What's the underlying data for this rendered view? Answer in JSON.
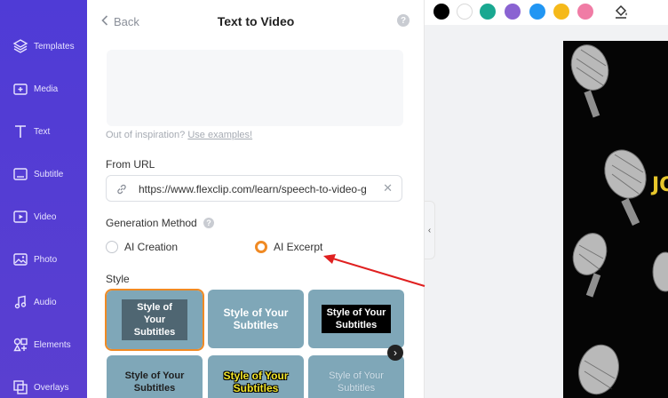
{
  "sidebar": {
    "items": [
      {
        "label": "Templates",
        "icon": "layers-icon"
      },
      {
        "label": "Media",
        "icon": "media-folder-icon"
      },
      {
        "label": "Text",
        "icon": "text-icon"
      },
      {
        "label": "Subtitle",
        "icon": "subtitle-icon"
      },
      {
        "label": "Video",
        "icon": "video-icon"
      },
      {
        "label": "Photo",
        "icon": "photo-icon"
      },
      {
        "label": "Audio",
        "icon": "audio-icon"
      },
      {
        "label": "Elements",
        "icon": "elements-icon"
      },
      {
        "label": "Overlays",
        "icon": "overlays-icon"
      }
    ]
  },
  "panel": {
    "back_label": "Back",
    "title": "Text to Video",
    "help": "?",
    "inspire_prefix": "Out of inspiration?",
    "inspire_link": "Use examples!",
    "from_url_label": "From URL",
    "url_value": "https://www.flexclip.com/learn/speech-to-video-g",
    "generation_label": "Generation Method",
    "options": [
      {
        "label": "AI Creation",
        "checked": false
      },
      {
        "label": "AI Excerpt",
        "checked": true
      }
    ],
    "style_label": "Style",
    "styles": [
      {
        "text": "Style of Your Subtitles"
      },
      {
        "text": "Style of Your Subtitles"
      },
      {
        "text": "Style of Your Subtitles"
      },
      {
        "text": "Style of Your Subtitles"
      },
      {
        "text": "Style of Your Subtitles"
      },
      {
        "text": "Style of Your Subtitles"
      }
    ]
  },
  "toolbar": {
    "swatches": [
      "#000000",
      "#ffffff",
      "#1aa891",
      "#8a63d2",
      "#2196f3",
      "#f5b91a",
      "#f07ca5"
    ]
  },
  "preview": {
    "partial_text": "JO"
  },
  "colors": {
    "accent": "#f08a24",
    "sidebar": "#5a3fd0",
    "arrow": "#e02020"
  }
}
